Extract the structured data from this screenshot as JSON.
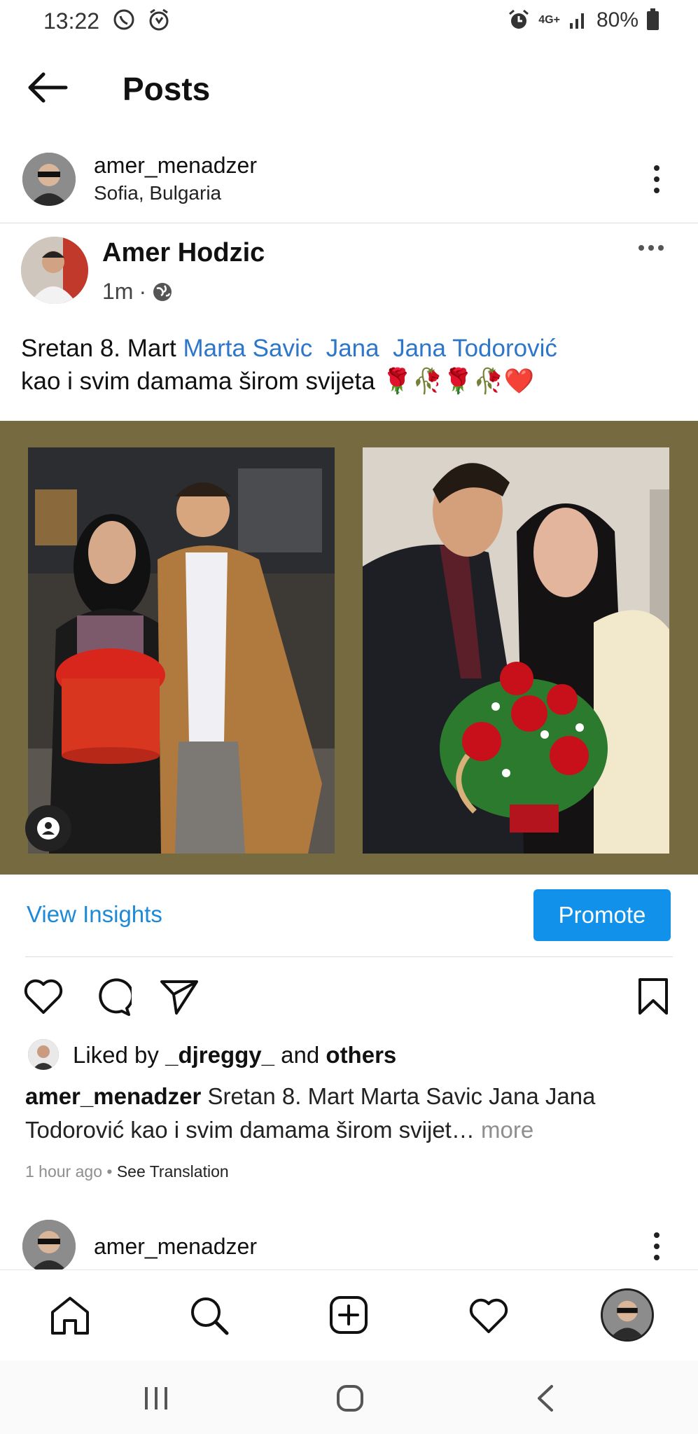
{
  "status_bar": {
    "time": "13:22",
    "network": "4G+",
    "battery": "80%"
  },
  "header": {
    "title": "Posts"
  },
  "post": {
    "username": "amer_menadzer",
    "location": "Sofia, Bulgaria",
    "embedded": {
      "author": "Amer Hodzic",
      "time": "1m",
      "text_prefix": "Sretan 8. Mart ",
      "tags": [
        "Marta Savic",
        "Jana",
        "Jana Todorović"
      ],
      "text_suffix": "kao i svim damama širom svijeta",
      "emojis": "🌹🥀🌹🥀❤️"
    },
    "view_insights_label": "View Insights",
    "promote_label": "Promote",
    "liked_by": {
      "prefix": "Liked by ",
      "user": "_djreggy_",
      "middle": " and ",
      "others": "others"
    },
    "caption": {
      "username": "amer_menadzer",
      "text_line1": " Sretan 8. Mart Marta Savic  Jana  Jana",
      "text_line2": "Todorović kao i svim damama širom svijet",
      "ellipsis": "… ",
      "more": "more"
    },
    "timestamp": "1 hour ago",
    "separator": " • ",
    "see_translation": "See Translation"
  },
  "next_post": {
    "username": "amer_menadzer"
  },
  "bottom_nav": [
    "home",
    "search",
    "new-post",
    "activity",
    "profile"
  ],
  "colors": {
    "link_blue": "#1c8ad8",
    "promote_bg": "#1191ea",
    "tag_blue": "#2e76c9",
    "collage_bg": "#766a40"
  }
}
